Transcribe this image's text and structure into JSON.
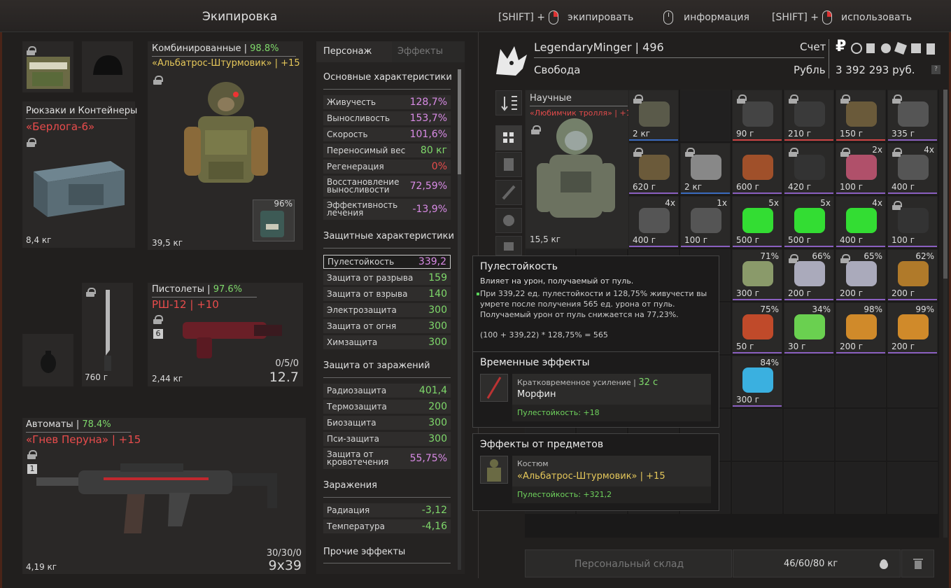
{
  "header": {
    "title": "Экипировка",
    "hints": [
      {
        "prefix": "[SHIFT] +",
        "label": "экипировать",
        "mouse": "r"
      },
      {
        "prefix": "",
        "label": "информация",
        "mouse": "l"
      },
      {
        "prefix": "[SHIFT] +",
        "label": "использовать",
        "mouse": "r"
      }
    ]
  },
  "equipment": {
    "armor": {
      "label": "Комбинированные",
      "durability": "98.8%",
      "name": "«Альбатрос-Штурмовик»",
      "upgrade": "| +15",
      "weight": "39,5 кг",
      "container_pct": "96%"
    },
    "backpack": {
      "label": "Рюкзаки и Контейнеры",
      "name": "«Берлога-6»",
      "weight": "8,4 кг"
    },
    "pistol": {
      "label": "Пистолеты",
      "durability": "97.6%",
      "name": "РШ-12",
      "upgrade": "| +10",
      "weight": "2,44 кг",
      "ammo": "0/5/0",
      "caliber": "12.7",
      "slot_number": "6"
    },
    "knife": {
      "weight": "760 г"
    },
    "rifle": {
      "label": "Автоматы",
      "durability": "78.4%",
      "name": "«Гнев Перуна»",
      "upgrade": "| +15",
      "weight": "4,19 кг",
      "ammo": "30/30/0",
      "caliber": "9x39",
      "slot_number": "1"
    }
  },
  "stats": {
    "tabs": [
      "Персонаж",
      "Эффекты"
    ],
    "basic_title": "Основные характеристики",
    "basic": [
      {
        "name": "Живучесть",
        "value": "128,7%",
        "color": "pink"
      },
      {
        "name": "Выносливость",
        "value": "153,7%",
        "color": "pink"
      },
      {
        "name": "Скорость",
        "value": "101,6%",
        "color": "pink"
      },
      {
        "name": "Переносимый вес",
        "value": "80 кг",
        "color": "green"
      },
      {
        "name": "Регенерация",
        "value": "0%",
        "color": "red"
      },
      {
        "name": "Восстановление выносливости",
        "value": "72,59%",
        "color": "pink"
      },
      {
        "name": "Эффективность лечения",
        "value": "-13,9%",
        "color": "pink"
      }
    ],
    "protection_title": "Защитные характеристики",
    "protection": [
      {
        "name": "Пулестойкость",
        "value": "339,2",
        "color": "pink"
      },
      {
        "name": "Защита от разрыва",
        "value": "159",
        "color": "green"
      },
      {
        "name": "Защита от взрыва",
        "value": "140",
        "color": "green"
      },
      {
        "name": "Электрозащита",
        "value": "300",
        "color": "green"
      },
      {
        "name": "Защита от огня",
        "value": "300",
        "color": "green"
      },
      {
        "name": "Химзащита",
        "value": "300",
        "color": "green"
      }
    ],
    "contam_title": "Защита от заражений",
    "contam": [
      {
        "name": "Радиозащита",
        "value": "401,4",
        "color": "green"
      },
      {
        "name": "Термозащита",
        "value": "200",
        "color": "green"
      },
      {
        "name": "Биозащита",
        "value": "300",
        "color": "green"
      },
      {
        "name": "Пси-защита",
        "value": "300",
        "color": "green"
      },
      {
        "name": "Защита от кровотечения",
        "value": "55,75%",
        "color": "pink"
      }
    ],
    "infection_title": "Заражения",
    "infection": [
      {
        "name": "Радиация",
        "value": "-3,12",
        "color": "green"
      },
      {
        "name": "Температура",
        "value": "-4,16",
        "color": "green"
      }
    ],
    "other_title": "Прочие эффекты"
  },
  "player": {
    "name": "LegendaryMinger | 496",
    "faction": "Свобода",
    "account_label": "Счет",
    "currency_label": "Рубль",
    "balance": "3 392 293 руб.",
    "ruble_symbol": "₽"
  },
  "inventory": {
    "big_item": {
      "label": "Научные",
      "name": "«Любимчик тролля» | +1...",
      "weight": "15,5 кг"
    },
    "cells": [
      {
        "c": 2,
        "r": 0,
        "w": "2 кг",
        "lock": true,
        "q": "",
        "u": "#3a6bbf"
      },
      {
        "c": 4,
        "r": 0,
        "w": "90 г",
        "lock": true,
        "q": "",
        "u": "#c44"
      },
      {
        "c": 5,
        "r": 0,
        "w": "210 г",
        "lock": true,
        "q": "",
        "u": "#c44"
      },
      {
        "c": 6,
        "r": 0,
        "w": "150 г",
        "lock": true,
        "q": "",
        "u": "#c44"
      },
      {
        "c": 7,
        "r": 0,
        "w": "335 г",
        "lock": true,
        "q": "",
        "u": "#8a5fc0"
      },
      {
        "c": 2,
        "r": 1,
        "w": "620 г",
        "lock": true,
        "q": "",
        "u": "#8a5fc0"
      },
      {
        "c": 3,
        "r": 1,
        "w": "2 кг",
        "lock": true,
        "q": "",
        "u": "#3a6bbf"
      },
      {
        "c": 4,
        "r": 1,
        "w": "600 г",
        "lock": false,
        "q": "",
        "u": "#8a5fc0"
      },
      {
        "c": 5,
        "r": 1,
        "w": "420 г",
        "lock": true,
        "q": "",
        "u": "#8a5fc0"
      },
      {
        "c": 6,
        "r": 1,
        "w": "100 г",
        "lock": true,
        "q": "2x",
        "u": "#8a5fc0"
      },
      {
        "c": 7,
        "r": 1,
        "w": "400 г",
        "lock": true,
        "q": "4x",
        "u": "#8a5fc0"
      },
      {
        "c": 2,
        "r": 2,
        "w": "400 г",
        "lock": false,
        "q": "4x",
        "u": "#8a5fc0"
      },
      {
        "c": 3,
        "r": 2,
        "w": "100 г",
        "lock": false,
        "q": "1x",
        "u": "#8a5fc0"
      },
      {
        "c": 4,
        "r": 2,
        "w": "500 г",
        "lock": false,
        "q": "5x",
        "u": "#8a5fc0"
      },
      {
        "c": 5,
        "r": 2,
        "w": "500 г",
        "lock": false,
        "q": "5x",
        "u": "#8a5fc0"
      },
      {
        "c": 6,
        "r": 2,
        "w": "400 г",
        "lock": false,
        "q": "4x",
        "u": "#8a5fc0"
      },
      {
        "c": 7,
        "r": 2,
        "w": "100 г",
        "lock": true,
        "q": "",
        "u": "#8a5fc0"
      },
      {
        "c": 4,
        "r": 3,
        "w": "300 г",
        "lock": false,
        "q": "71%",
        "u": "#8a5fc0"
      },
      {
        "c": 5,
        "r": 3,
        "w": "200 г",
        "lock": true,
        "q": "66%",
        "u": "#8a5fc0"
      },
      {
        "c": 6,
        "r": 3,
        "w": "200 г",
        "lock": true,
        "q": "65%",
        "u": "#8a5fc0"
      },
      {
        "c": 7,
        "r": 3,
        "w": "200 г",
        "lock": false,
        "q": "62%",
        "u": "#8a5fc0"
      },
      {
        "c": 4,
        "r": 4,
        "w": "50 г",
        "lock": false,
        "q": "75%",
        "u": "#8a5fc0"
      },
      {
        "c": 5,
        "r": 4,
        "w": "30 г",
        "lock": false,
        "q": "34%",
        "u": "#8a5fc0"
      },
      {
        "c": 6,
        "r": 4,
        "w": "200 г",
        "lock": false,
        "q": "98%",
        "u": "#8a5fc0"
      },
      {
        "c": 7,
        "r": 4,
        "w": "200 г",
        "lock": false,
        "q": "99%",
        "u": "#8a5fc0"
      },
      {
        "c": 4,
        "r": 5,
        "w": "300 г",
        "lock": false,
        "q": "84%",
        "u": "#8a5fc0"
      }
    ]
  },
  "tooltip": {
    "title": "Пулестойкость",
    "subtitle": "Влияет на урон, получаемый от пуль.",
    "body1": "При 339,22 ед. пулестойкости и 128,75% живучести вы",
    "body2": "умрете после получения 565 ед. урона от пуль.",
    "body3": "Получаемый урон от пуль снижается на 77,23%.",
    "formula": "(100 + 339,22) * 128,75% = 565"
  },
  "temp_effects": {
    "title": "Временные эффекты",
    "kind": "Кратковременное усиление |",
    "time": "32 с",
    "name": "Морфин",
    "bonus": "Пулестойкость: +18"
  },
  "item_effects": {
    "title": "Эффекты от предметов",
    "kind": "Костюм",
    "name": "«Альбатрос-Штурмовик» | +15",
    "bonus": "Пулестойкость: +321,2"
  },
  "footer": {
    "storage": "Персональный склад",
    "weight": "46/60/80 кг"
  }
}
